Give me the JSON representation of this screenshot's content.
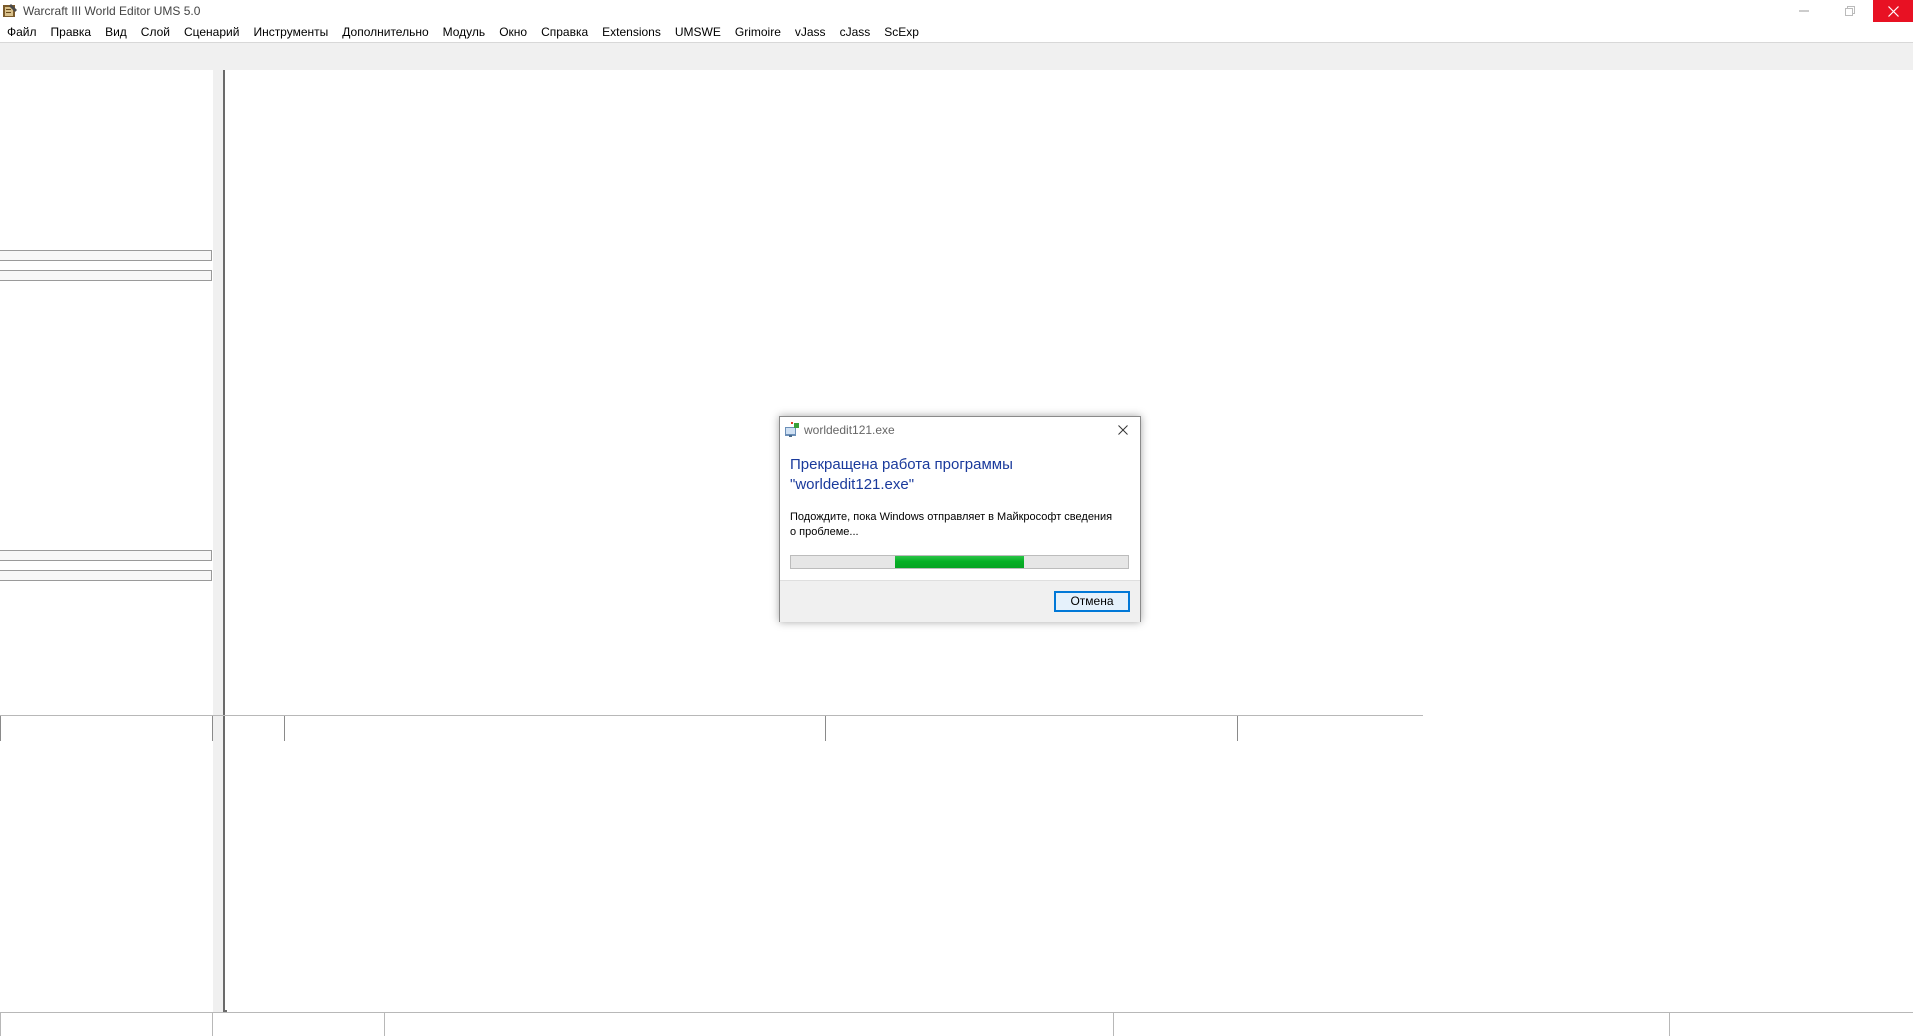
{
  "window": {
    "title": "Warcraft III World Editor UMS 5.0",
    "icon": "world-editor-icon"
  },
  "menu": {
    "items": [
      {
        "label": "Файл"
      },
      {
        "label": "Правка"
      },
      {
        "label": "Вид"
      },
      {
        "label": "Слой"
      },
      {
        "label": "Сценарий"
      },
      {
        "label": "Инструменты"
      },
      {
        "label": "Дополнительно"
      },
      {
        "label": "Модуль"
      },
      {
        "label": "Окно"
      },
      {
        "label": "Справка"
      },
      {
        "label": "Extensions"
      },
      {
        "label": "UMSWE"
      },
      {
        "label": "Grimoire"
      },
      {
        "label": "vJass"
      },
      {
        "label": "cJass"
      },
      {
        "label": "ScExp"
      }
    ]
  },
  "dialog": {
    "title": "worldedit121.exe",
    "heading": "Прекращена работа программы \"worldedit121.exe\"",
    "message": "Подождите, пока Windows отправляет в Майкрософт сведения о проблеме...",
    "progress": {
      "start_fraction": 0.31,
      "end_fraction": 0.69
    },
    "cancel_label": "Отмена",
    "icon": "windows-error-reporting-icon"
  },
  "colors": {
    "close_button_bg": "#e81123",
    "dialog_heading": "#1a3a9c",
    "progress_fill": "#06b025",
    "button_border": "#0078d7"
  }
}
